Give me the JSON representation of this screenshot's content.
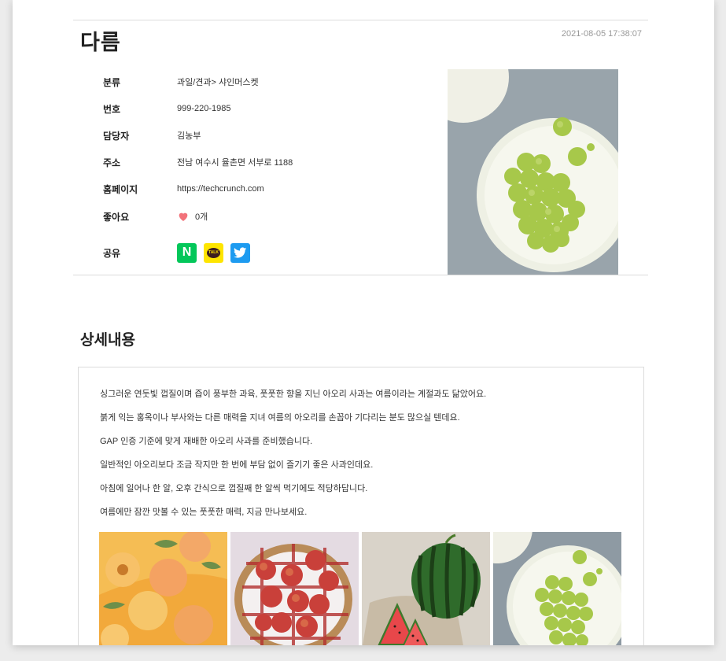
{
  "product": {
    "title": "다름",
    "date": "2021-08-05 17:38:07"
  },
  "info": {
    "category": {
      "label": "분류",
      "value": "과일/견과> 샤인머스켓"
    },
    "number": {
      "label": "번호",
      "value": "999-220-1985"
    },
    "manager": {
      "label": "담당자",
      "value": "김농부"
    },
    "address": {
      "label": "주소",
      "value": "전남 여수시 율촌면 서부로 1188"
    },
    "homepage": {
      "label": "홈페이지",
      "value": "https://techcrunch.com"
    },
    "likes": {
      "label": "좋아요",
      "value": "0개"
    },
    "share": {
      "label": "공유",
      "naver": "N",
      "kakao": "TALK"
    }
  },
  "detail": {
    "section_title": "상세내용",
    "lines": [
      "싱그러운 연둣빛 껍질이며 즙이 풍부한 과육, 풋풋한 향을 지닌 아오리 사과는 여름이라는 계절과도 닮았어요.",
      "붉게 익는 홍옥이나 부사와는 다른 매력을 지녀 여름의 아오리를 손꼽아 기다리는 분도 많으실 텐데요.",
      "GAP 인증 기준에 맞게 재배한 아오리 사과를 준비했습니다.",
      "일반적인 아오리보다 조금 작지만 한 번에 부담 없이 즐기기 좋은 사과인데요.",
      "아침에 일어나 한 알, 오후 간식으로 껍질째 한 알씩 먹기에도 적당하답니다.",
      "여름에만 잠깐 맛볼 수 있는 풋풋한 매력, 지금 만나보세요."
    ]
  },
  "colors": {
    "naver": "#03c75a",
    "kakao": "#fee500",
    "twitter": "#1d9bf0",
    "heart": "#f2727a"
  }
}
